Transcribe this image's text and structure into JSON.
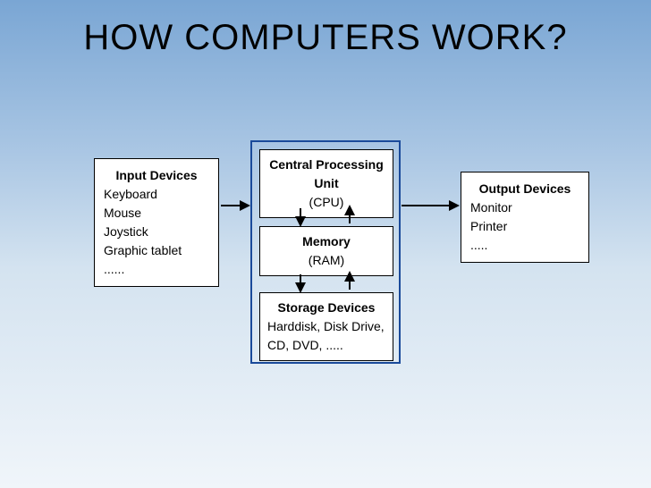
{
  "title": "HOW COMPUTERS WORK?",
  "input": {
    "label": "Input Devices",
    "items": "Keyboard\nMouse\nJoystick\nGraphic tablet\n......"
  },
  "output": {
    "label": "Output Devices",
    "items": "Monitor\nPrinter\n....."
  },
  "cpu": {
    "label": "Central Processing Unit",
    "sub": "(CPU)"
  },
  "memory": {
    "label": "Memory",
    "sub": "(RAM)"
  },
  "storage": {
    "label": "Storage Devices",
    "items": "Harddisk, Disk Drive, CD, DVD, ....."
  }
}
